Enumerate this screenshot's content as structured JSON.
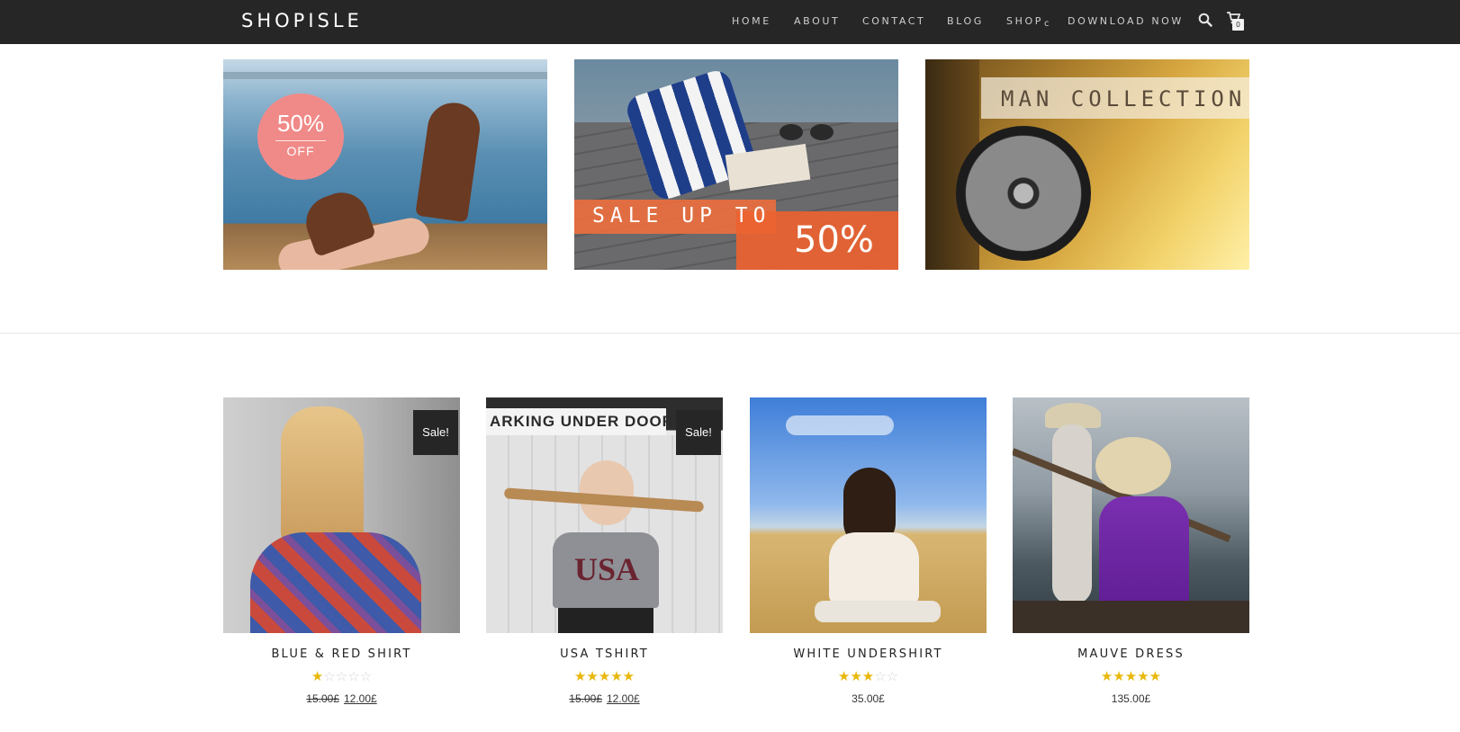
{
  "header": {
    "logo": "SHOPISLE",
    "nav": [
      {
        "label": "HOME"
      },
      {
        "label": "ABOUT"
      },
      {
        "label": "CONTACT"
      },
      {
        "label": "BLOG"
      },
      {
        "label": "SHOP",
        "caret": "c"
      },
      {
        "label": "DOWNLOAD NOW"
      }
    ],
    "icons": {
      "search": "search-icon",
      "cart": "cart-icon"
    },
    "cart_count": "0",
    "background": "#262626"
  },
  "banners": [
    {
      "badge_value": "50%",
      "badge_sub": "OFF",
      "badge_color": "#f08a88"
    },
    {
      "line1": "SALE UP TO",
      "line2": "50%",
      "accent": "#ec6230"
    },
    {
      "text": "MAN COLLECTION"
    }
  ],
  "products": [
    {
      "title": "BLUE & RED SHIRT",
      "sale": "Sale!",
      "rating": 1,
      "rating_max": 5,
      "old_price": "15.00£",
      "price": "12.00£"
    },
    {
      "title": "USA TSHIRT",
      "sale": "Sale!",
      "rating": 5,
      "rating_max": 5,
      "old_price": "15.00£",
      "price": "12.00£"
    },
    {
      "title": "WHITE UNDERSHIRT",
      "sale": "",
      "rating": 3,
      "rating_max": 5,
      "old_price": "",
      "price": "35.00£"
    },
    {
      "title": "MAUVE DRESS",
      "sale": "",
      "rating": 5,
      "rating_max": 5,
      "old_price": "",
      "price": "135.00£"
    }
  ],
  "product_images": {
    "p2_sign": "ARKING UNDER DOOR",
    "p2_shirt": "USA"
  },
  "colors": {
    "star": "#e8b80a",
    "star_empty": "#d6d6d6",
    "sale_badge": "#262626"
  }
}
